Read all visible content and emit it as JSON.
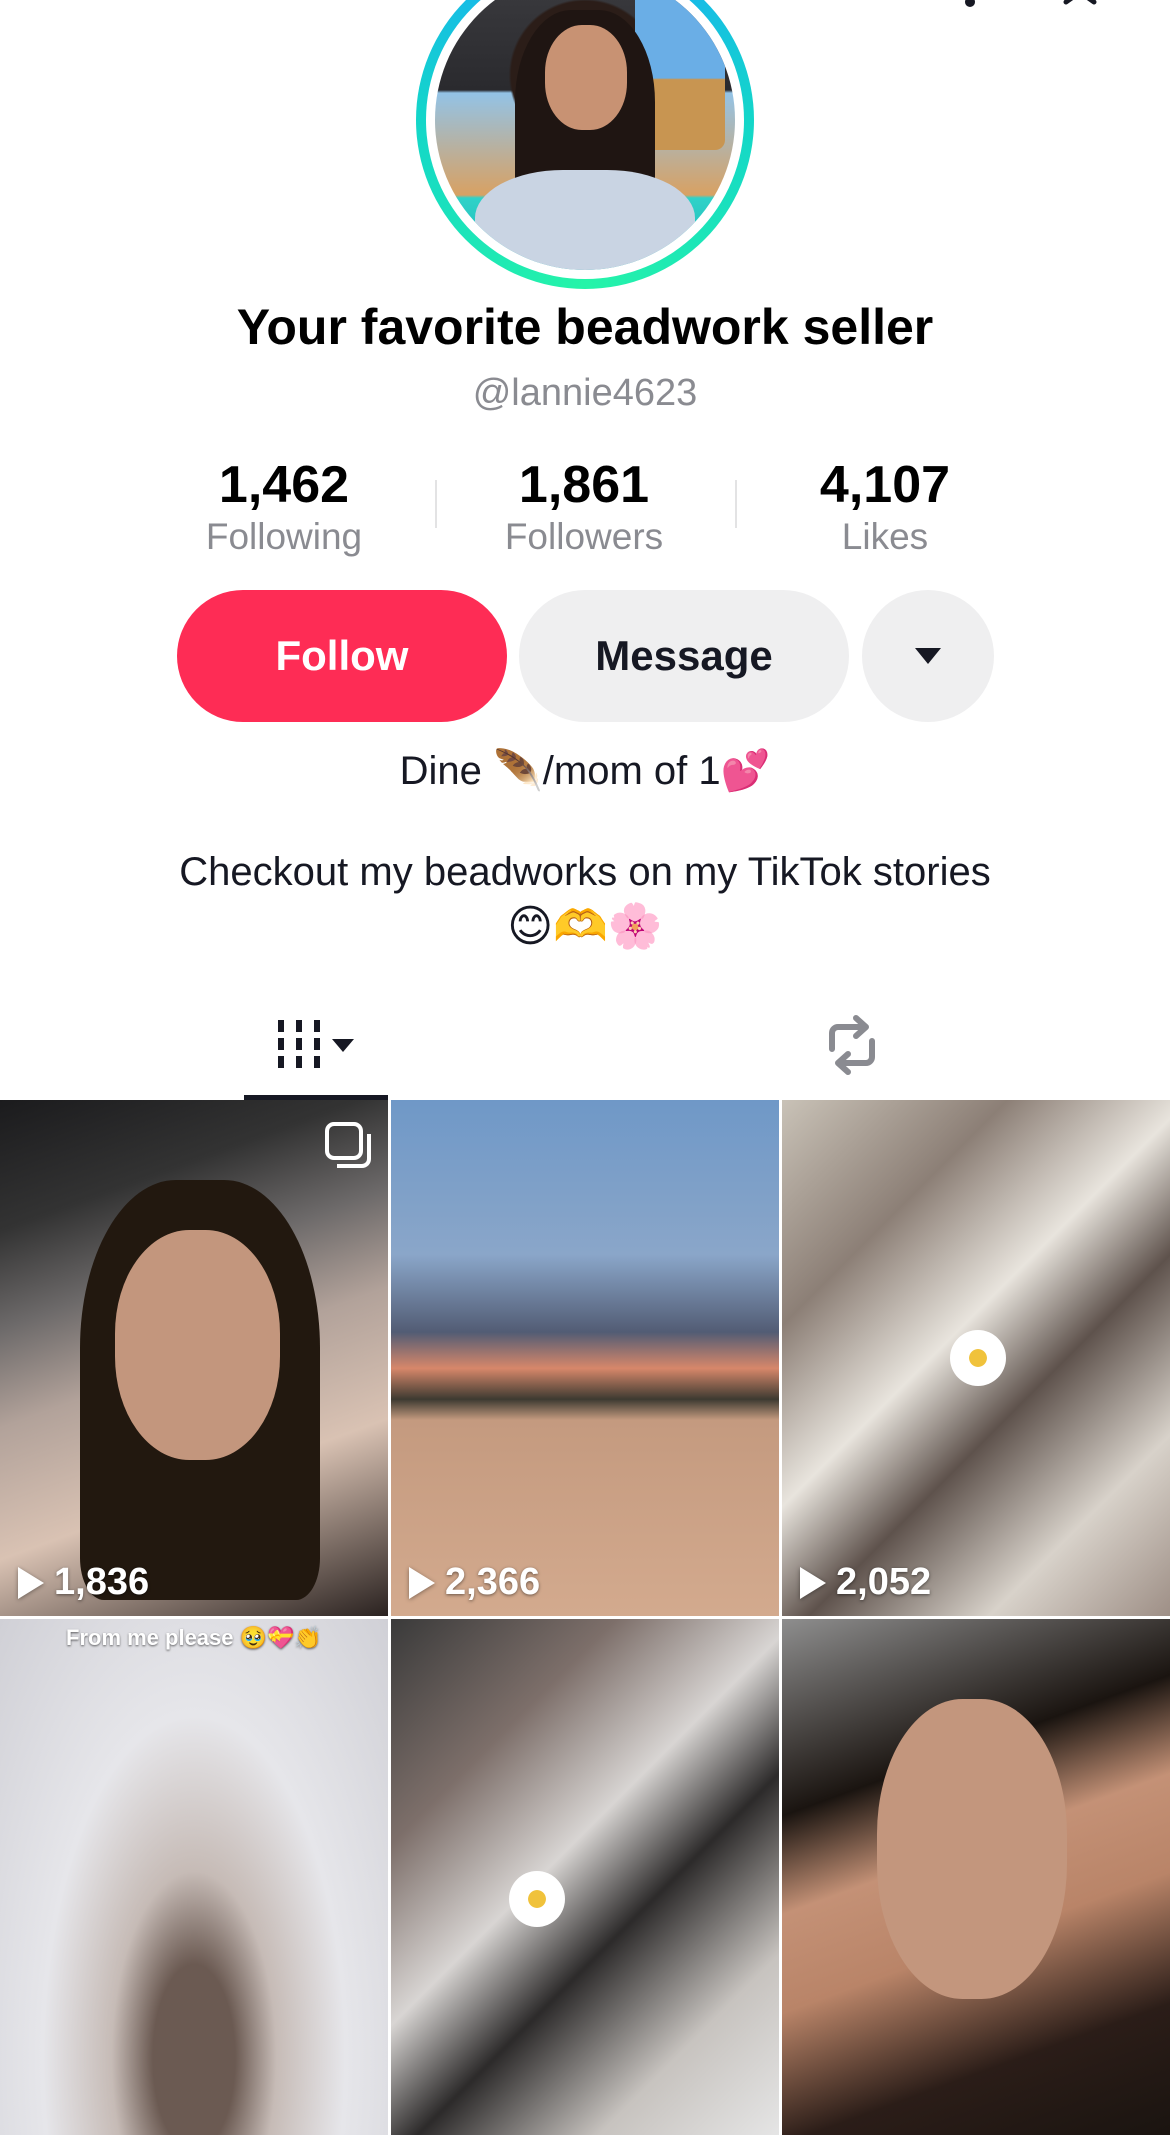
{
  "profile": {
    "display_name": "Your favorite beadwork seller",
    "username": "@lannie4623"
  },
  "stats": {
    "following": {
      "value": "1,462",
      "label": "Following"
    },
    "followers": {
      "value": "1,861",
      "label": "Followers"
    },
    "likes": {
      "value": "4,107",
      "label": "Likes"
    }
  },
  "actions": {
    "follow_label": "Follow",
    "message_label": "Message",
    "more_icon": "caret-down-icon"
  },
  "bio": {
    "line1": "Dine 🪶/mom of 1💕",
    "line2": "Checkout my beadworks on my TikTok stories",
    "line3": "😊🫶🌸"
  },
  "tabs": [
    {
      "name": "videos",
      "icon": "grid-bars-icon",
      "active": true
    },
    {
      "name": "reposts",
      "icon": "repost-icon",
      "active": false
    }
  ],
  "videos": [
    {
      "views": "1,836",
      "pinned": true
    },
    {
      "views": "2,366"
    },
    {
      "views": "2,052"
    },
    {
      "caption": "From me please 🥹💝👏"
    },
    {},
    {}
  ],
  "colors": {
    "accent": "#fe2c55",
    "secondary_button": "#efeff0",
    "muted_text": "#8a8b91"
  }
}
